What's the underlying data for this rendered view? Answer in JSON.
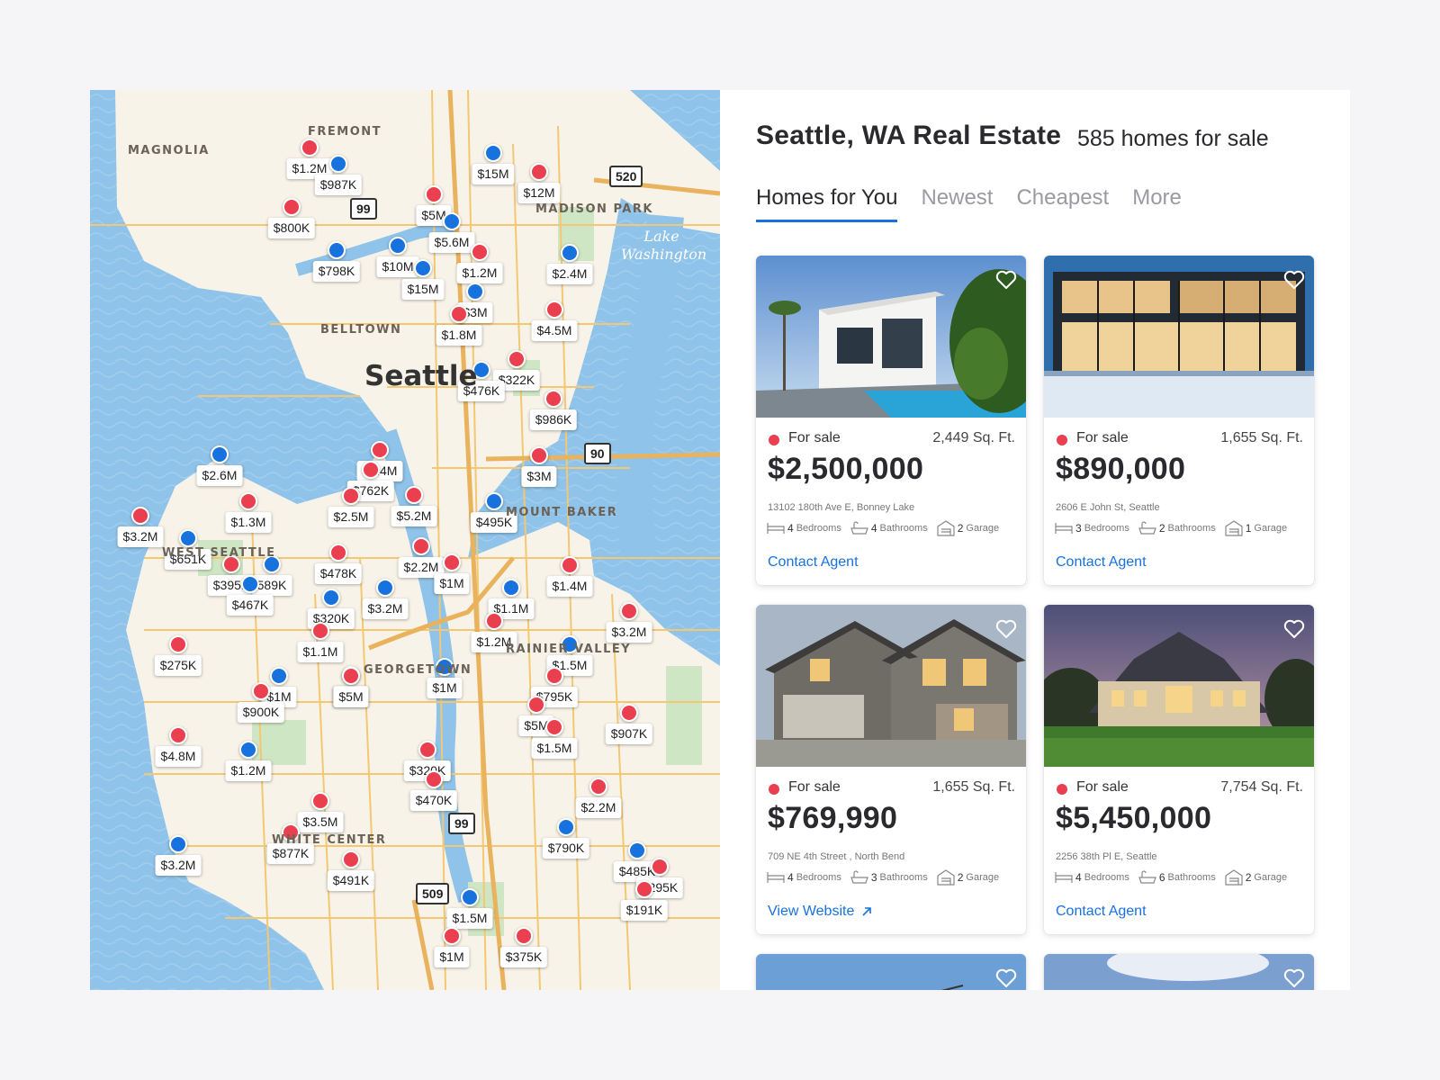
{
  "header": {
    "title": "Seattle, WA Real Estate",
    "count": "585 homes for sale"
  },
  "tabs": [
    {
      "label": "Homes for You",
      "active": true
    },
    {
      "label": "Newest",
      "active": false
    },
    {
      "label": "Cheapest",
      "active": false
    },
    {
      "label": "More",
      "active": false
    }
  ],
  "map": {
    "city": "Seattle",
    "lake": "Lake Washington",
    "districts": [
      "MAGNOLIA",
      "FREMONT",
      "MADISON PARK",
      "BELLTOWN",
      "MOUNT BAKER",
      "WEST SEATTLE",
      "GEORGETOWN",
      "RAINIER VALLEY",
      "WHITE CENTER"
    ],
    "highways": [
      "99",
      "520",
      "90",
      "99",
      "509"
    ],
    "pins": [
      {
        "color": "red",
        "label": "$1.2M"
      },
      {
        "color": "blue",
        "label": "$987K"
      },
      {
        "color": "red",
        "label": "$800K"
      },
      {
        "color": "blue",
        "label": "$798K"
      },
      {
        "color": "blue",
        "label": "$15M"
      },
      {
        "color": "red",
        "label": "$12M"
      },
      {
        "color": "red",
        "label": "$5M"
      },
      {
        "color": "blue",
        "label": "$5.6M"
      },
      {
        "color": "blue",
        "label": "$10M"
      },
      {
        "color": "red",
        "label": "$1.2M"
      },
      {
        "color": "blue",
        "label": "$2.4M"
      },
      {
        "color": "blue",
        "label": "$15M"
      },
      {
        "color": "blue",
        "label": "$3M"
      },
      {
        "color": "red",
        "label": "$4.5M"
      },
      {
        "color": "red",
        "label": "$1.8M"
      },
      {
        "color": "red",
        "label": "$322K"
      },
      {
        "color": "blue",
        "label": "$476K"
      },
      {
        "color": "red",
        "label": "$986K"
      },
      {
        "color": "blue",
        "label": "$2.6M"
      },
      {
        "color": "red",
        "label": "$1.4M"
      },
      {
        "color": "red",
        "label": "$762K"
      },
      {
        "color": "red",
        "label": "$3M"
      },
      {
        "color": "red",
        "label": "$1.3M"
      },
      {
        "color": "red",
        "label": "$5.2M"
      },
      {
        "color": "red",
        "label": "$2.5M"
      },
      {
        "color": "blue",
        "label": "$495K"
      },
      {
        "color": "red",
        "label": "$3.2M"
      },
      {
        "color": "blue",
        "label": "$651K"
      },
      {
        "color": "red",
        "label": "$395K"
      },
      {
        "color": "blue",
        "label": "589K"
      },
      {
        "color": "red",
        "label": "$478K"
      },
      {
        "color": "red",
        "label": "$2.2M"
      },
      {
        "color": "red",
        "label": "$1M"
      },
      {
        "color": "red",
        "label": "$1.4M"
      },
      {
        "color": "blue",
        "label": "$467K"
      },
      {
        "color": "blue",
        "label": "$320K"
      },
      {
        "color": "blue",
        "label": "$3.2M"
      },
      {
        "color": "red",
        "label": "$5M"
      },
      {
        "color": "blue",
        "label": "$1.1M"
      },
      {
        "color": "red",
        "label": "$3.2M"
      },
      {
        "color": "red",
        "label": "$1.1M"
      },
      {
        "color": "red",
        "label": "$1.2M"
      },
      {
        "color": "blue",
        "label": "$1.5M"
      },
      {
        "color": "red",
        "label": "$275K"
      },
      {
        "color": "blue",
        "label": "$1M"
      },
      {
        "color": "red",
        "label": "$5M"
      },
      {
        "color": "blue",
        "label": "$1M"
      },
      {
        "color": "red",
        "label": "$900K"
      },
      {
        "color": "red",
        "label": "$795K"
      },
      {
        "color": "red",
        "label": "$4.8M"
      },
      {
        "color": "red",
        "label": "$5M"
      },
      {
        "color": "red",
        "label": "$907K"
      },
      {
        "color": "blue",
        "label": "$1.2M"
      },
      {
        "color": "red",
        "label": "$1.5M"
      },
      {
        "color": "red",
        "label": "$320K"
      },
      {
        "color": "red",
        "label": "$470K"
      },
      {
        "color": "red",
        "label": "$2.2M"
      },
      {
        "color": "red",
        "label": "$3.5M"
      },
      {
        "color": "red",
        "label": "$877K"
      },
      {
        "color": "blue",
        "label": "$790K"
      },
      {
        "color": "blue",
        "label": "$3.2M"
      },
      {
        "color": "red",
        "label": "$491K"
      },
      {
        "color": "blue",
        "label": "$485K"
      },
      {
        "color": "red",
        "label": "$295K"
      },
      {
        "color": "blue",
        "label": "$1.5M"
      },
      {
        "color": "red",
        "label": "$191K"
      },
      {
        "color": "red",
        "label": "$1M"
      },
      {
        "color": "red",
        "label": "$375K"
      }
    ]
  },
  "listings": [
    {
      "status": "For sale",
      "sqft": "2,449 Sq. Ft.",
      "price": "$2,500,000",
      "address": "13102 180th Ave E, Bonney Lake",
      "beds": "4",
      "beds_label": "Bedrooms",
      "baths": "4",
      "baths_label": "Bathrooms",
      "garage": "2",
      "garage_label": "Garage",
      "cta": "Contact Agent",
      "photo": "modern-white-villa-pool"
    },
    {
      "status": "For sale",
      "sqft": "1,655 Sq. Ft.",
      "price": "$890,000",
      "address": "2606 E John St, Seattle",
      "beds": "3",
      "beds_label": "Bedrooms",
      "baths": "2",
      "baths_label": "Bathrooms",
      "garage": "1",
      "garage_label": "Garage",
      "cta": "Contact Agent",
      "photo": "glass-house-night"
    },
    {
      "status": "For sale",
      "sqft": "1,655 Sq. Ft.",
      "price": "$769,990",
      "address": "709 NE 4th Street , North Bend",
      "beds": "4",
      "beds_label": "Bedrooms",
      "baths": "3",
      "baths_label": "Bathrooms",
      "garage": "2",
      "garage_label": "Garage",
      "cta": "View Website",
      "photo": "suburban-two-story"
    },
    {
      "status": "For sale",
      "sqft": "7,754 Sq. Ft.",
      "price": "$5,450,000",
      "address": "2256 38th Pl E, Seattle",
      "beds": "4",
      "beds_label": "Bedrooms",
      "baths": "6",
      "baths_label": "Bathrooms",
      "garage": "2",
      "garage_label": "Garage",
      "cta": "Contact Agent",
      "photo": "mansion-dusk"
    }
  ],
  "colors": {
    "accent": "#1872de",
    "status_red": "#ea3f4f",
    "pin_blue": "#1872de",
    "water": "#8fc3e9",
    "land": "#f8f3e8"
  }
}
